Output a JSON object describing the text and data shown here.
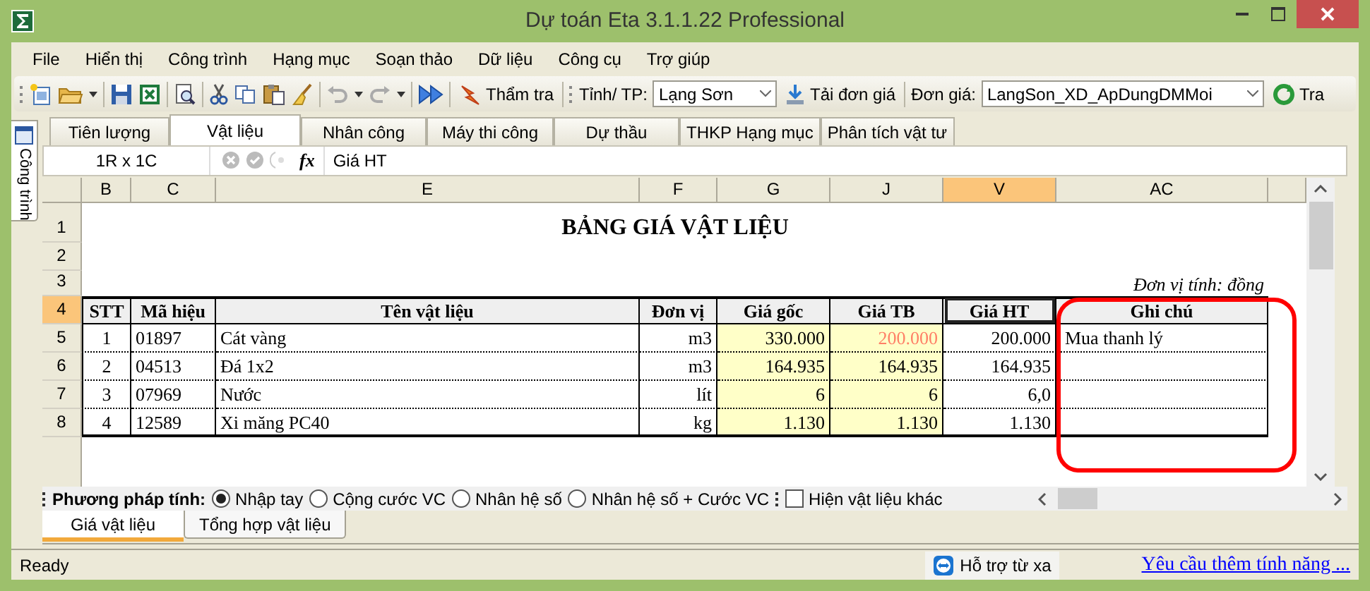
{
  "window": {
    "title": "Dự toán Eta 3.1.1.22 Professional"
  },
  "menu": [
    "File",
    "Hiển thị",
    "Công trình",
    "Hạng mục",
    "Soạn thảo",
    "Dữ liệu",
    "Công cụ",
    "Trợ giúp"
  ],
  "toolbar": {
    "review_button": "Thẩm tra",
    "province_label": "Tỉnh/ TP:",
    "province": "Lạng Sơn",
    "download_button": "Tải đơn giá",
    "price_label": "Đơn giá:",
    "price_set": "LangSon_XD_ApDungDMMoi",
    "lookup_button": "Tra"
  },
  "side_tab": "Công trình",
  "tabs": [
    {
      "label": "Tiên lượng",
      "selected": false
    },
    {
      "label": "Vật liệu",
      "selected": true
    },
    {
      "label": "Nhân công",
      "selected": false
    },
    {
      "label": "Máy thi công",
      "selected": false
    },
    {
      "label": "Dự thầu",
      "selected": false
    },
    {
      "label": "THKP Hạng mục",
      "selected": false
    },
    {
      "label": "Phân tích vật tư",
      "selected": false
    }
  ],
  "formula_bar": {
    "cell_ref": "1R x 1C",
    "fx": "fx",
    "value": "Giá HT"
  },
  "sheet": {
    "columns": [
      {
        "label": "B",
        "selected": false
      },
      {
        "label": "C",
        "selected": false
      },
      {
        "label": "E",
        "selected": false
      },
      {
        "label": "F",
        "selected": false
      },
      {
        "label": "G",
        "selected": false
      },
      {
        "label": "J",
        "selected": false
      },
      {
        "label": "V",
        "selected": true
      },
      {
        "label": "AC",
        "selected": false
      }
    ],
    "row_numbers": [
      {
        "label": "1",
        "selected": false
      },
      {
        "label": "2",
        "selected": false
      },
      {
        "label": "3",
        "selected": false
      },
      {
        "label": "4",
        "selected": true
      },
      {
        "label": "5",
        "selected": false
      },
      {
        "label": "6",
        "selected": false
      },
      {
        "label": "7",
        "selected": false
      },
      {
        "label": "8",
        "selected": false
      }
    ],
    "title": "BẢNG GIÁ VẬT LIỆU",
    "unit_note": "Đơn vị tính: đồng",
    "headers": [
      {
        "label": "STT",
        "active": false
      },
      {
        "label": "Mã hiệu",
        "active": false
      },
      {
        "label": "Tên vật liệu",
        "active": false
      },
      {
        "label": "Đơn vị",
        "active": false
      },
      {
        "label": "Giá gốc",
        "active": false
      },
      {
        "label": "Giá TB",
        "active": false
      },
      {
        "label": "Giá HT",
        "active": true
      },
      {
        "label": "Ghi chú",
        "active": false
      }
    ],
    "rows": [
      {
        "stt": "1",
        "code": "01897",
        "name": "Cát vàng",
        "unit": "m3",
        "base_price": "330.000",
        "avg_price": "200.000",
        "avg_price_edited": true,
        "current_price": "200.000",
        "note": "Mua thanh lý"
      },
      {
        "stt": "2",
        "code": "04513",
        "name": "Đá 1x2",
        "unit": "m3",
        "base_price": "164.935",
        "avg_price": "164.935",
        "avg_price_edited": false,
        "current_price": "164.935"
      },
      {
        "stt": "3",
        "code": "07969",
        "name": "Nước",
        "unit": "lít",
        "base_price": "6",
        "avg_price": "6",
        "avg_price_edited": false,
        "current_price": "6,0"
      },
      {
        "stt": "4",
        "code": "12589",
        "name": "Xi măng PC40",
        "unit": "kg",
        "base_price": "1.130",
        "avg_price": "1.130",
        "avg_price_edited": false,
        "current_price": "1.130"
      }
    ]
  },
  "calc_method": {
    "label": "Phương pháp tính:",
    "options": [
      {
        "label": "Nhập tay",
        "selected": true
      },
      {
        "label": "Cộng cước VC",
        "selected": false
      },
      {
        "label": "Nhân hệ số",
        "selected": false
      },
      {
        "label": "Nhân hệ số + Cước VC",
        "selected": false
      }
    ]
  },
  "show_other": {
    "label": "Hiện vật liệu khác",
    "checked": false
  },
  "sheet_tabs": [
    {
      "label": "Giá vật liệu",
      "selected": true
    },
    {
      "label": "Tổng hợp vật liệu",
      "selected": false
    }
  ],
  "status_bar": {
    "text": "Ready",
    "remote_support": "Hỗ trợ từ xa",
    "feature_link": "Yêu cầu thêm tính năng ..."
  }
}
